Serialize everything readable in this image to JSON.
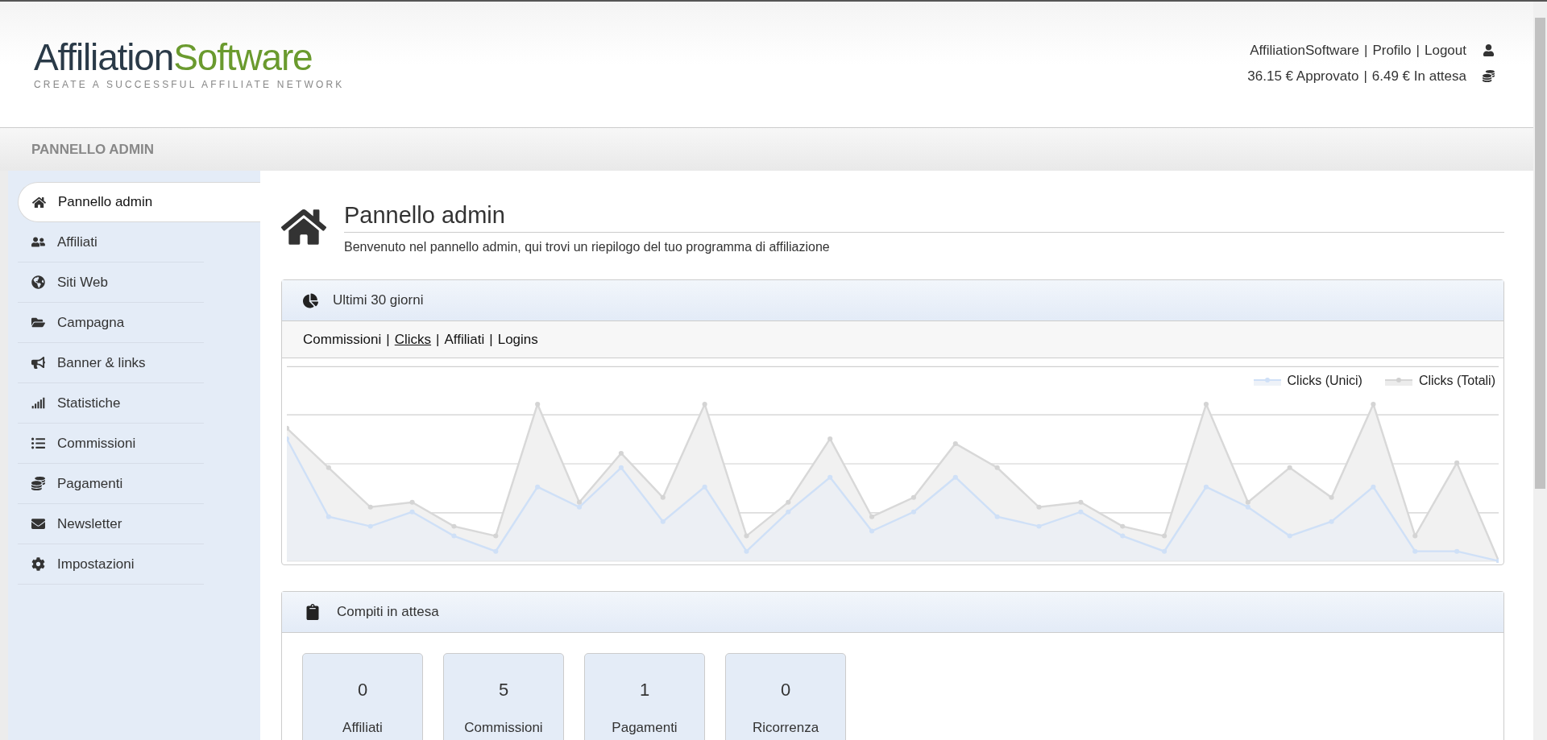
{
  "logo": {
    "part_1": "Affiliation",
    "part_2": "Software",
    "tagline": "CREATE A SUCCESSFUL AFFILIATE NETWORK"
  },
  "separator": "|",
  "user_links": [
    "AffiliationSoftware",
    "Profilo",
    "Logout"
  ],
  "balances": [
    "36.15 € Approvato",
    "6.49 € In attesa"
  ],
  "admin_bar": {
    "title": "PANNELLO ADMIN"
  },
  "sidebar": {
    "items": [
      {
        "label": "Pannello admin",
        "selected": true
      },
      {
        "label": "Affiliati",
        "selected": false
      },
      {
        "label": "Siti Web",
        "selected": false
      },
      {
        "label": "Campagna",
        "selected": false
      },
      {
        "label": "Banner & links",
        "selected": false
      },
      {
        "label": "Statistiche",
        "selected": false
      },
      {
        "label": "Commissioni",
        "selected": false
      },
      {
        "label": "Pagamenti",
        "selected": false
      },
      {
        "label": "Newsletter",
        "selected": false
      },
      {
        "label": "Impostazioni",
        "selected": false
      }
    ]
  },
  "page": {
    "title": "Pannello admin",
    "subtitle": "Benvenuto nel pannello admin, qui trovi un riepilogo del tuo programma di affiliazione"
  },
  "stats_panel": {
    "title": "Ultimi 30 giorni",
    "tabs": [
      {
        "label": "Commissioni",
        "selected": false
      },
      {
        "label": "Clicks",
        "selected": true
      },
      {
        "label": "Affiliati",
        "selected": false
      },
      {
        "label": "Logins",
        "selected": false
      }
    ],
    "legend": [
      "Clicks (Unici)",
      "Clicks (Totali)"
    ]
  },
  "tasks_panel": {
    "title": "Compiti in attesa",
    "tiles": [
      {
        "count": "0",
        "label": "Affiliati"
      },
      {
        "count": "5",
        "label": "Commissioni"
      },
      {
        "count": "1",
        "label": "Pagamenti"
      },
      {
        "count": "0",
        "label": "Ricorrenza"
      }
    ]
  }
}
